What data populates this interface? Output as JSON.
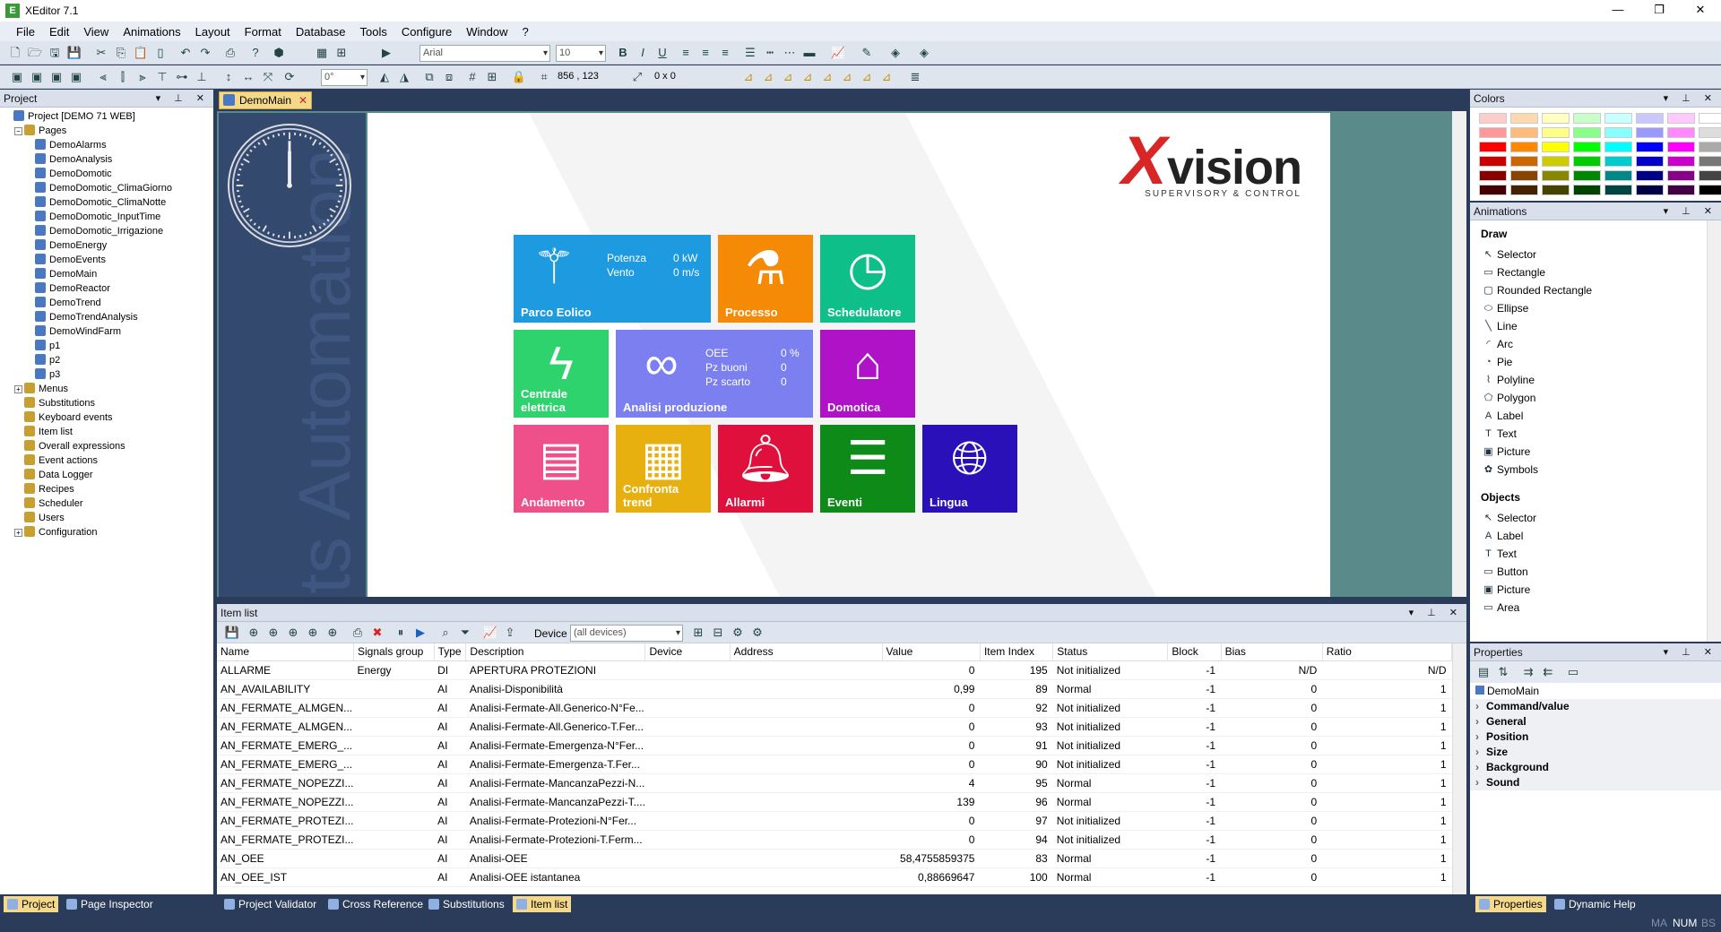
{
  "window": {
    "title": "XEditor 7.1",
    "app_icon": "xeditor-icon",
    "btn_min": "—",
    "btn_max": "❐",
    "btn_close": "✕"
  },
  "menu": [
    "File",
    "Edit",
    "View",
    "Animations",
    "Layout",
    "Format",
    "Database",
    "Tools",
    "Configure",
    "Window",
    "?"
  ],
  "toolbar": {
    "font": "Arial",
    "size": "10",
    "angle": "0°",
    "coords": "856 , 123",
    "dims": "0 x 0"
  },
  "project_panel": {
    "title": "Project",
    "controls": "▾ ⊥ ✕",
    "tree": [
      {
        "label": "Project [DEMO 71 WEB]",
        "level": 0,
        "exp": ""
      },
      {
        "label": "Pages",
        "level": 1,
        "exp": "−"
      },
      {
        "label": "DemoAlarms",
        "level": 2
      },
      {
        "label": "DemoAnalysis",
        "level": 2
      },
      {
        "label": "DemoDomotic",
        "level": 2
      },
      {
        "label": "DemoDomotic_ClimaGiorno",
        "level": 2
      },
      {
        "label": "DemoDomotic_ClimaNotte",
        "level": 2
      },
      {
        "label": "DemoDomotic_InputTime",
        "level": 2
      },
      {
        "label": "DemoDomotic_Irrigazione",
        "level": 2
      },
      {
        "label": "DemoEnergy",
        "level": 2
      },
      {
        "label": "DemoEvents",
        "level": 2
      },
      {
        "label": "DemoMain",
        "level": 2
      },
      {
        "label": "DemoReactor",
        "level": 2
      },
      {
        "label": "DemoTrend",
        "level": 2
      },
      {
        "label": "DemoTrendAnalysis",
        "level": 2
      },
      {
        "label": "DemoWindFarm",
        "level": 2
      },
      {
        "label": "p1",
        "level": 2
      },
      {
        "label": "p2",
        "level": 2
      },
      {
        "label": "p3",
        "level": 2
      },
      {
        "label": "Menus",
        "level": 1,
        "exp": "+"
      },
      {
        "label": "Substitutions",
        "level": 1
      },
      {
        "label": "Keyboard events",
        "level": 1
      },
      {
        "label": "Item list",
        "level": 1
      },
      {
        "label": "Overall expressions",
        "level": 1
      },
      {
        "label": "Event actions",
        "level": 1
      },
      {
        "label": "Data Logger",
        "level": 1
      },
      {
        "label": "Recipes",
        "level": 1
      },
      {
        "label": "Scheduler",
        "level": 1
      },
      {
        "label": "Users",
        "level": 1
      },
      {
        "label": "Configuration",
        "level": 1,
        "exp": "+"
      }
    ]
  },
  "doc": {
    "tab": "DemoMain",
    "tab_close": "✕",
    "vertical_text": "ets Automation",
    "logo": {
      "x": "X",
      "v": "vision",
      "sub": "SUPERVISORY & CONTROL"
    },
    "tiles": [
      {
        "id": "parco",
        "label": "Parco Eolico",
        "color": "#1e9be0",
        "info": [
          "Potenza",
          "0  kW",
          "Vento",
          "0  m/s"
        ]
      },
      {
        "id": "processo",
        "label": "Processo",
        "color": "#f58a07"
      },
      {
        "id": "schedulatore",
        "label": "Schedulatore",
        "color": "#0fbf8a"
      },
      {
        "id": "centrale",
        "label": "Centrale elettrica",
        "color": "#2fd36d"
      },
      {
        "id": "analisi",
        "label": "Analisi produzione",
        "color": "#7b7ff0",
        "info": [
          "OEE",
          "0  %",
          "Pz buoni",
          "0",
          "Pz scarto",
          "0"
        ]
      },
      {
        "id": "domotica",
        "label": "Domotica",
        "color": "#b012c8"
      },
      {
        "id": "andamento",
        "label": "Andamento",
        "color": "#f0508a"
      },
      {
        "id": "confronta",
        "label": "Confronta trend",
        "color": "#e8b00e"
      },
      {
        "id": "allarmi",
        "label": "Allarmi",
        "color": "#e0103c"
      },
      {
        "id": "eventi",
        "label": "Eventi",
        "color": "#0e8a18"
      },
      {
        "id": "lingua",
        "label": "Lingua",
        "color": "#2a10b8"
      }
    ]
  },
  "itemlist": {
    "title": "Item list",
    "device_label": "Device",
    "device_value": "(all devices)",
    "columns": [
      "Name",
      "Signals group",
      "Type",
      "Description",
      "Device",
      "Address",
      "Value",
      "Item Index",
      "Status",
      "Block",
      "Bias",
      "Ratio"
    ],
    "rows": [
      [
        "ALLARME",
        "Energy",
        "DI",
        "APERTURA PROTEZIONI",
        "",
        "",
        "0",
        "195",
        "Not initialized",
        "-1",
        "N/D",
        "N/D"
      ],
      [
        "AN_AVAILABILITY",
        "",
        "AI",
        "Analisi-Disponibilità",
        "",
        "",
        "0,99",
        "89",
        "Normal",
        "-1",
        "0",
        "1"
      ],
      [
        "AN_FERMATE_ALMGEN...",
        "",
        "AI",
        "Analisi-Fermate-All.Generico-N°Fe...",
        "",
        "",
        "0",
        "92",
        "Not initialized",
        "-1",
        "0",
        "1"
      ],
      [
        "AN_FERMATE_ALMGEN...",
        "",
        "AI",
        "Analisi-Fermate-All.Generico-T.Fer...",
        "",
        "",
        "0",
        "93",
        "Not initialized",
        "-1",
        "0",
        "1"
      ],
      [
        "AN_FERMATE_EMERG_...",
        "",
        "AI",
        "Analisi-Fermate-Emergenza-N°Fer...",
        "",
        "",
        "0",
        "91",
        "Not initialized",
        "-1",
        "0",
        "1"
      ],
      [
        "AN_FERMATE_EMERG_...",
        "",
        "AI",
        "Analisi-Fermate-Emergenza-T.Fer...",
        "",
        "",
        "0",
        "90",
        "Not initialized",
        "-1",
        "0",
        "1"
      ],
      [
        "AN_FERMATE_NOPEZZI...",
        "",
        "AI",
        "Analisi-Fermate-MancanzaPezzi-N...",
        "",
        "",
        "4",
        "95",
        "Normal",
        "-1",
        "0",
        "1"
      ],
      [
        "AN_FERMATE_NOPEZZI...",
        "",
        "AI",
        "Analisi-Fermate-MancanzaPezzi-T....",
        "",
        "",
        "139",
        "96",
        "Normal",
        "-1",
        "0",
        "1"
      ],
      [
        "AN_FERMATE_PROTEZI...",
        "",
        "AI",
        "Analisi-Fermate-Protezioni-N°Fer...",
        "",
        "",
        "0",
        "97",
        "Not initialized",
        "-1",
        "0",
        "1"
      ],
      [
        "AN_FERMATE_PROTEZI...",
        "",
        "AI",
        "Analisi-Fermate-Protezioni-T.Ferm...",
        "",
        "",
        "0",
        "94",
        "Not initialized",
        "-1",
        "0",
        "1"
      ],
      [
        "AN_OEE",
        "",
        "AI",
        "Analisi-OEE",
        "",
        "",
        "58,4755859375",
        "83",
        "Normal",
        "-1",
        "0",
        "1"
      ],
      [
        "AN_OEE_IST",
        "",
        "AI",
        "Analisi-OEE istantanea",
        "",
        "",
        "0,88669647",
        "100",
        "Normal",
        "-1",
        "0",
        "1"
      ]
    ]
  },
  "colors_panel": {
    "title": "Colors",
    "swatches": [
      "#ffcccc",
      "#ffd8b0",
      "#ffffc0",
      "#c8ffc8",
      "#c8ffff",
      "#c8c8ff",
      "#ffc8ff",
      "#ffffff",
      "#ff9999",
      "#ffbb77",
      "#ffff88",
      "#88ff88",
      "#88ffff",
      "#9999ff",
      "#ff88ff",
      "#dddddd",
      "#ff0000",
      "#ff8800",
      "#ffff00",
      "#00ff00",
      "#00ffff",
      "#0000ff",
      "#ff00ff",
      "#aaaaaa",
      "#cc0000",
      "#cc6600",
      "#cccc00",
      "#00cc00",
      "#00cccc",
      "#0000cc",
      "#cc00cc",
      "#777777",
      "#880000",
      "#884400",
      "#888800",
      "#008800",
      "#008888",
      "#000088",
      "#880088",
      "#444444",
      "#440000",
      "#442200",
      "#444400",
      "#004400",
      "#004444",
      "#000044",
      "#440044",
      "#000000"
    ]
  },
  "anim_panel": {
    "title": "Animations",
    "draw_title": "Draw",
    "draw": [
      [
        "Selector",
        "↖"
      ],
      [
        "Rectangle",
        "▭"
      ],
      [
        "Rounded Rectangle",
        "▢"
      ],
      [
        "Ellipse",
        "⬭"
      ],
      [
        "Line",
        "╲"
      ],
      [
        "Arc",
        "◜"
      ],
      [
        "Pie",
        "◔"
      ],
      [
        "Polyline",
        "⌇"
      ],
      [
        "Polygon",
        "⬠"
      ],
      [
        "Label",
        "A"
      ],
      [
        "Text",
        "T"
      ],
      [
        "Picture",
        "▣"
      ],
      [
        "Symbols",
        "✿"
      ]
    ],
    "objects_title": "Objects",
    "objects": [
      [
        "Selector",
        "↖"
      ],
      [
        "Label",
        "A"
      ],
      [
        "Text",
        "T"
      ],
      [
        "Button",
        "▭"
      ],
      [
        "Picture",
        "▣"
      ],
      [
        "Area",
        "▭"
      ]
    ]
  },
  "props_panel": {
    "title": "Properties",
    "root": "DemoMain",
    "groups": [
      "Command/value",
      "General",
      "Position",
      "Size",
      "Background",
      "Sound"
    ]
  },
  "bottom_tabs": {
    "left": [
      [
        "Project",
        true
      ],
      [
        "Page Inspector",
        false
      ]
    ],
    "center": [
      [
        "Project Validator",
        false
      ],
      [
        "Cross Reference",
        false
      ],
      [
        "Substitutions",
        false
      ],
      [
        "Item list",
        true
      ]
    ],
    "right": [
      [
        "Properties",
        true
      ],
      [
        "Dynamic Help",
        false
      ]
    ]
  },
  "status": {
    "ma": "MA",
    "num": "NUM",
    "bs": "BS"
  }
}
